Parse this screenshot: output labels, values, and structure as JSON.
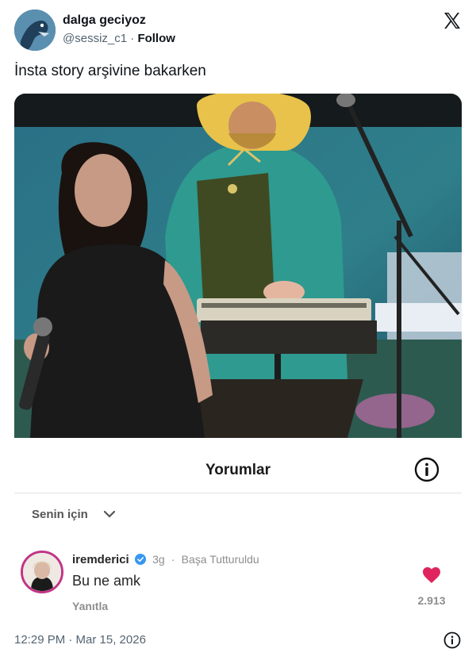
{
  "tweet": {
    "author_name": "dalga geciyoz",
    "handle": "@sessiz_c1",
    "separator": "·",
    "follow_label": "Follow",
    "text": "İnsta story arşivine bakarken",
    "timestamp": "12:29 PM · Mar 15, 2026"
  },
  "comments_panel": {
    "title": "Yorumlar",
    "filter_label": "Senin için",
    "comment": {
      "username": "iremderici",
      "age": "3g",
      "separator": "·",
      "pinned_label": "Başa Tutturuldu",
      "text": "Bu ne amk",
      "reply_label": "Yanıtla",
      "likes": "2.913"
    }
  },
  "colors": {
    "heart": "#e0245e",
    "verified": "#3897f0",
    "secondary_text": "#536471"
  },
  "icons": [
    "x-logo-icon",
    "info-icon",
    "chevron-down-icon",
    "verified-icon",
    "heart-icon"
  ]
}
